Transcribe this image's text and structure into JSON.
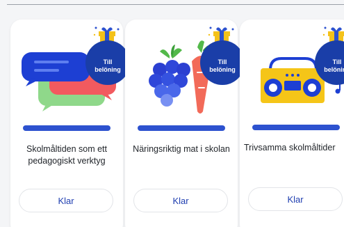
{
  "cards": [
    {
      "title": "Skolmåltiden som ett pedagogiskt verktyg",
      "reward_line1": "Till",
      "reward_line2": "belöning",
      "button_label": "Klar",
      "illustration": "speech-bubbles-icon"
    },
    {
      "title": "Näringsriktig mat i skolan",
      "reward_line1": "Till",
      "reward_line2": "belöning",
      "button_label": "Klar",
      "illustration": "berries-carrot-icon"
    },
    {
      "title": "Trivsamma skolmåltider",
      "reward_line1": "Till",
      "reward_line2": "belöning",
      "button_label": "Klar",
      "illustration": "boombox-icon"
    }
  ],
  "colors": {
    "badge": "#1a3ea8",
    "progress": "#2d52cf",
    "button_text": "#1f3eb0",
    "gift": "#f4c21a"
  }
}
